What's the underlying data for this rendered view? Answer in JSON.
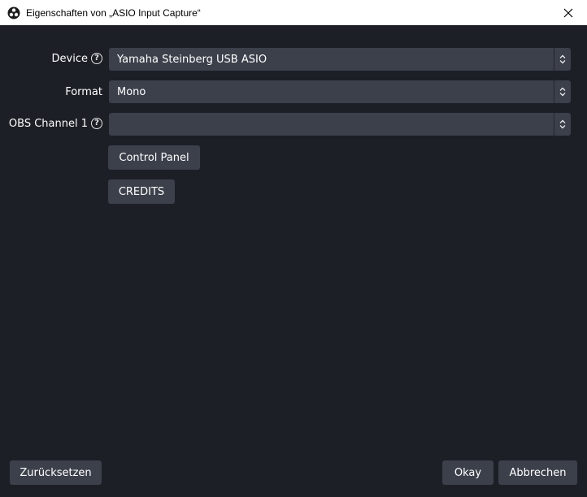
{
  "window": {
    "title": "Eigenschaften von „ASIO Input Capture“",
    "app_icon": "obs-logo-icon",
    "close_icon": "close-icon"
  },
  "form": {
    "device": {
      "label": "Device",
      "value": "Yamaha Steinberg USB ASIO",
      "help_icon": "help-icon"
    },
    "format": {
      "label": "Format",
      "value": "Mono"
    },
    "obs_channel_1": {
      "label": "OBS Channel 1",
      "value": "",
      "help_icon": "help-icon"
    },
    "control_panel_label": "Control Panel",
    "credits_label": "CREDITS"
  },
  "footer": {
    "reset_label": "Zurücksetzen",
    "ok_label": "Okay",
    "cancel_label": "Abbrechen"
  },
  "colors": {
    "background": "#1d1f26",
    "control": "#3c404b",
    "titlebar": "#ffffff"
  }
}
